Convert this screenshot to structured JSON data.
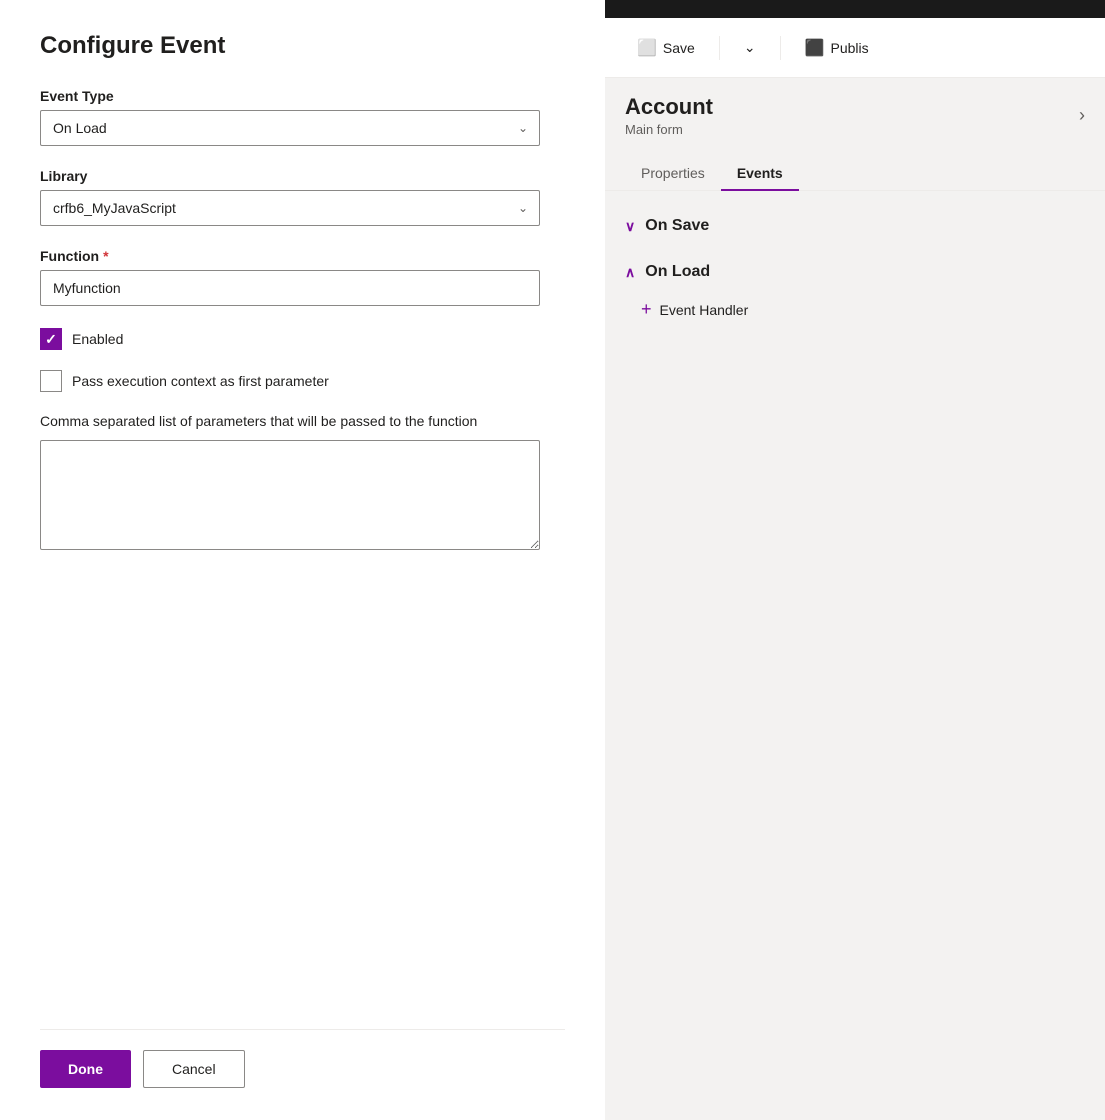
{
  "dialog": {
    "title": "Configure Event",
    "event_type_label": "Event Type",
    "event_type_value": "On Load",
    "library_label": "Library",
    "library_value": "crfb6_MyJavaScript",
    "function_label": "Function",
    "function_required": "*",
    "function_value": "Myfunction",
    "enabled_label": "Enabled",
    "pass_context_label": "Pass execution context as first parameter",
    "params_label": "Comma separated list of parameters that will be passed to the function",
    "params_value": "",
    "done_label": "Done",
    "cancel_label": "Cancel"
  },
  "right_panel": {
    "toolbar": {
      "save_label": "Save",
      "publish_label": "Publis"
    },
    "account": {
      "name": "Account",
      "subtitle": "Main form",
      "chevron": "›"
    },
    "tabs": [
      {
        "label": "Properties",
        "active": false
      },
      {
        "label": "Events",
        "active": true
      }
    ],
    "events": {
      "on_save": {
        "title": "On Save",
        "collapsed": true
      },
      "on_load": {
        "title": "On Load",
        "collapsed": false
      },
      "event_handler_label": "+ Event Handler"
    }
  }
}
